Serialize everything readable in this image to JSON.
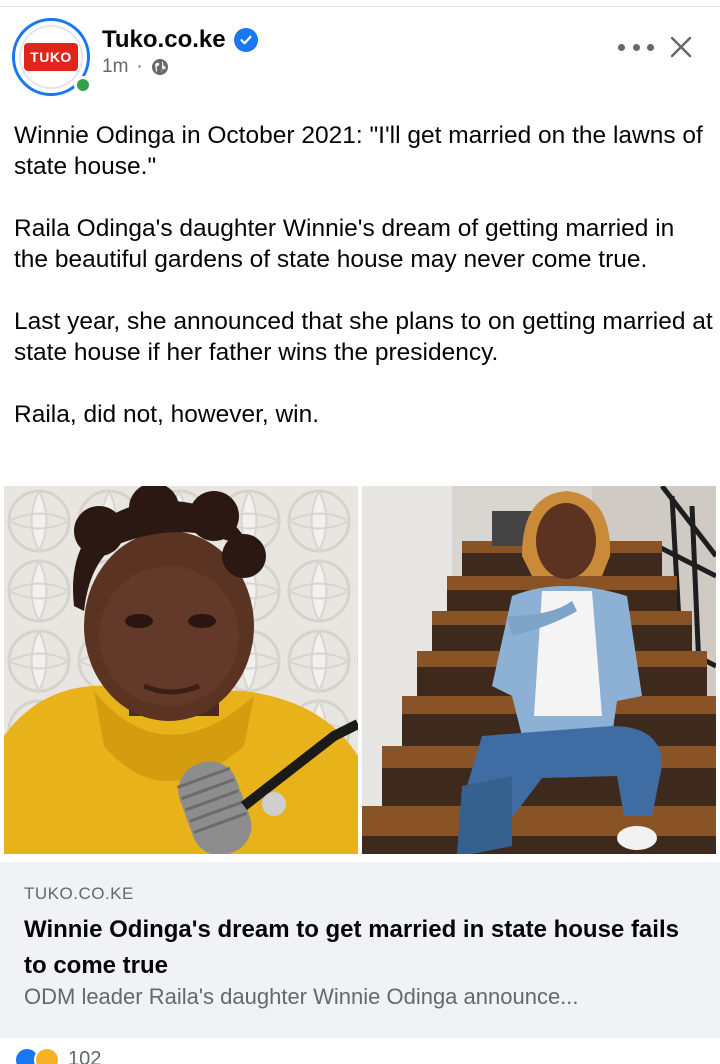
{
  "post": {
    "page_name": "Tuko.co.ke",
    "logo_text": "TUKO",
    "time": "1m",
    "separator": "·",
    "paragraphs": [
      "Winnie Odinga in October 2021: \"I'll get married on the lawns of state house.\"",
      "Raila Odinga's daughter Winnie's dream of getting married in the beautiful gardens of state house may never come true.",
      "Last year, she announced that she plans to on getting married at state house if her father wins the presidency.",
      "Raila, did not, however, win."
    ]
  },
  "link_preview": {
    "domain": "TUKO.CO.KE",
    "title": "Winnie Odinga's dream to get married in state house fails to come true",
    "description": "ODM leader Raila's daughter Winnie Odinga announce..."
  },
  "reactions": {
    "count": "102",
    "icons": [
      "like-icon",
      "haha-icon"
    ]
  },
  "colors": {
    "brand_red": "#e1251b",
    "verified_blue": "#1877f2",
    "online_green": "#31a24c",
    "card_bg": "#f0f2f5"
  }
}
